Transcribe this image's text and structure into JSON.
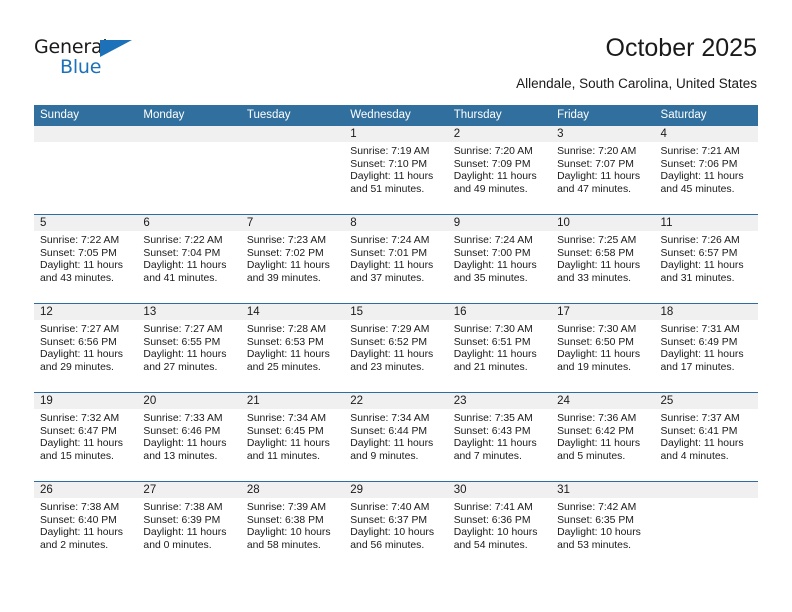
{
  "brand": {
    "name_top": "General",
    "name_bottom": "Blue",
    "accent_color": "#1d71b8",
    "triangle_icon": "triangle-icon"
  },
  "header": {
    "title": "October 2025",
    "subtitle": "Allendale, South Carolina, United States"
  },
  "theme": {
    "header_row_bg": "#31709e",
    "row_separator": "#2e6da4",
    "daynum_bg": "#f0f0f0",
    "text": "#1a1a1a"
  },
  "calendar": {
    "weekday_headers": [
      "Sunday",
      "Monday",
      "Tuesday",
      "Wednesday",
      "Thursday",
      "Friday",
      "Saturday"
    ],
    "labels": {
      "sunrise": "Sunrise:",
      "sunset": "Sunset:",
      "daylight": "Daylight:"
    },
    "weeks": [
      [
        {
          "day": "",
          "sunrise": "",
          "sunset": "",
          "daylight": ""
        },
        {
          "day": "",
          "sunrise": "",
          "sunset": "",
          "daylight": ""
        },
        {
          "day": "",
          "sunrise": "",
          "sunset": "",
          "daylight": ""
        },
        {
          "day": "1",
          "sunrise": "Sunrise: 7:19 AM",
          "sunset": "Sunset: 7:10 PM",
          "daylight": "Daylight: 11 hours and 51 minutes."
        },
        {
          "day": "2",
          "sunrise": "Sunrise: 7:20 AM",
          "sunset": "Sunset: 7:09 PM",
          "daylight": "Daylight: 11 hours and 49 minutes."
        },
        {
          "day": "3",
          "sunrise": "Sunrise: 7:20 AM",
          "sunset": "Sunset: 7:07 PM",
          "daylight": "Daylight: 11 hours and 47 minutes."
        },
        {
          "day": "4",
          "sunrise": "Sunrise: 7:21 AM",
          "sunset": "Sunset: 7:06 PM",
          "daylight": "Daylight: 11 hours and 45 minutes."
        }
      ],
      [
        {
          "day": "5",
          "sunrise": "Sunrise: 7:22 AM",
          "sunset": "Sunset: 7:05 PM",
          "daylight": "Daylight: 11 hours and 43 minutes."
        },
        {
          "day": "6",
          "sunrise": "Sunrise: 7:22 AM",
          "sunset": "Sunset: 7:04 PM",
          "daylight": "Daylight: 11 hours and 41 minutes."
        },
        {
          "day": "7",
          "sunrise": "Sunrise: 7:23 AM",
          "sunset": "Sunset: 7:02 PM",
          "daylight": "Daylight: 11 hours and 39 minutes."
        },
        {
          "day": "8",
          "sunrise": "Sunrise: 7:24 AM",
          "sunset": "Sunset: 7:01 PM",
          "daylight": "Daylight: 11 hours and 37 minutes."
        },
        {
          "day": "9",
          "sunrise": "Sunrise: 7:24 AM",
          "sunset": "Sunset: 7:00 PM",
          "daylight": "Daylight: 11 hours and 35 minutes."
        },
        {
          "day": "10",
          "sunrise": "Sunrise: 7:25 AM",
          "sunset": "Sunset: 6:58 PM",
          "daylight": "Daylight: 11 hours and 33 minutes."
        },
        {
          "day": "11",
          "sunrise": "Sunrise: 7:26 AM",
          "sunset": "Sunset: 6:57 PM",
          "daylight": "Daylight: 11 hours and 31 minutes."
        }
      ],
      [
        {
          "day": "12",
          "sunrise": "Sunrise: 7:27 AM",
          "sunset": "Sunset: 6:56 PM",
          "daylight": "Daylight: 11 hours and 29 minutes."
        },
        {
          "day": "13",
          "sunrise": "Sunrise: 7:27 AM",
          "sunset": "Sunset: 6:55 PM",
          "daylight": "Daylight: 11 hours and 27 minutes."
        },
        {
          "day": "14",
          "sunrise": "Sunrise: 7:28 AM",
          "sunset": "Sunset: 6:53 PM",
          "daylight": "Daylight: 11 hours and 25 minutes."
        },
        {
          "day": "15",
          "sunrise": "Sunrise: 7:29 AM",
          "sunset": "Sunset: 6:52 PM",
          "daylight": "Daylight: 11 hours and 23 minutes."
        },
        {
          "day": "16",
          "sunrise": "Sunrise: 7:30 AM",
          "sunset": "Sunset: 6:51 PM",
          "daylight": "Daylight: 11 hours and 21 minutes."
        },
        {
          "day": "17",
          "sunrise": "Sunrise: 7:30 AM",
          "sunset": "Sunset: 6:50 PM",
          "daylight": "Daylight: 11 hours and 19 minutes."
        },
        {
          "day": "18",
          "sunrise": "Sunrise: 7:31 AM",
          "sunset": "Sunset: 6:49 PM",
          "daylight": "Daylight: 11 hours and 17 minutes."
        }
      ],
      [
        {
          "day": "19",
          "sunrise": "Sunrise: 7:32 AM",
          "sunset": "Sunset: 6:47 PM",
          "daylight": "Daylight: 11 hours and 15 minutes."
        },
        {
          "day": "20",
          "sunrise": "Sunrise: 7:33 AM",
          "sunset": "Sunset: 6:46 PM",
          "daylight": "Daylight: 11 hours and 13 minutes."
        },
        {
          "day": "21",
          "sunrise": "Sunrise: 7:34 AM",
          "sunset": "Sunset: 6:45 PM",
          "daylight": "Daylight: 11 hours and 11 minutes."
        },
        {
          "day": "22",
          "sunrise": "Sunrise: 7:34 AM",
          "sunset": "Sunset: 6:44 PM",
          "daylight": "Daylight: 11 hours and 9 minutes."
        },
        {
          "day": "23",
          "sunrise": "Sunrise: 7:35 AM",
          "sunset": "Sunset: 6:43 PM",
          "daylight": "Daylight: 11 hours and 7 minutes."
        },
        {
          "day": "24",
          "sunrise": "Sunrise: 7:36 AM",
          "sunset": "Sunset: 6:42 PM",
          "daylight": "Daylight: 11 hours and 5 minutes."
        },
        {
          "day": "25",
          "sunrise": "Sunrise: 7:37 AM",
          "sunset": "Sunset: 6:41 PM",
          "daylight": "Daylight: 11 hours and 4 minutes."
        }
      ],
      [
        {
          "day": "26",
          "sunrise": "Sunrise: 7:38 AM",
          "sunset": "Sunset: 6:40 PM",
          "daylight": "Daylight: 11 hours and 2 minutes."
        },
        {
          "day": "27",
          "sunrise": "Sunrise: 7:38 AM",
          "sunset": "Sunset: 6:39 PM",
          "daylight": "Daylight: 11 hours and 0 minutes."
        },
        {
          "day": "28",
          "sunrise": "Sunrise: 7:39 AM",
          "sunset": "Sunset: 6:38 PM",
          "daylight": "Daylight: 10 hours and 58 minutes."
        },
        {
          "day": "29",
          "sunrise": "Sunrise: 7:40 AM",
          "sunset": "Sunset: 6:37 PM",
          "daylight": "Daylight: 10 hours and 56 minutes."
        },
        {
          "day": "30",
          "sunrise": "Sunrise: 7:41 AM",
          "sunset": "Sunset: 6:36 PM",
          "daylight": "Daylight: 10 hours and 54 minutes."
        },
        {
          "day": "31",
          "sunrise": "Sunrise: 7:42 AM",
          "sunset": "Sunset: 6:35 PM",
          "daylight": "Daylight: 10 hours and 53 minutes."
        },
        {
          "day": "",
          "sunrise": "",
          "sunset": "",
          "daylight": ""
        }
      ]
    ]
  }
}
